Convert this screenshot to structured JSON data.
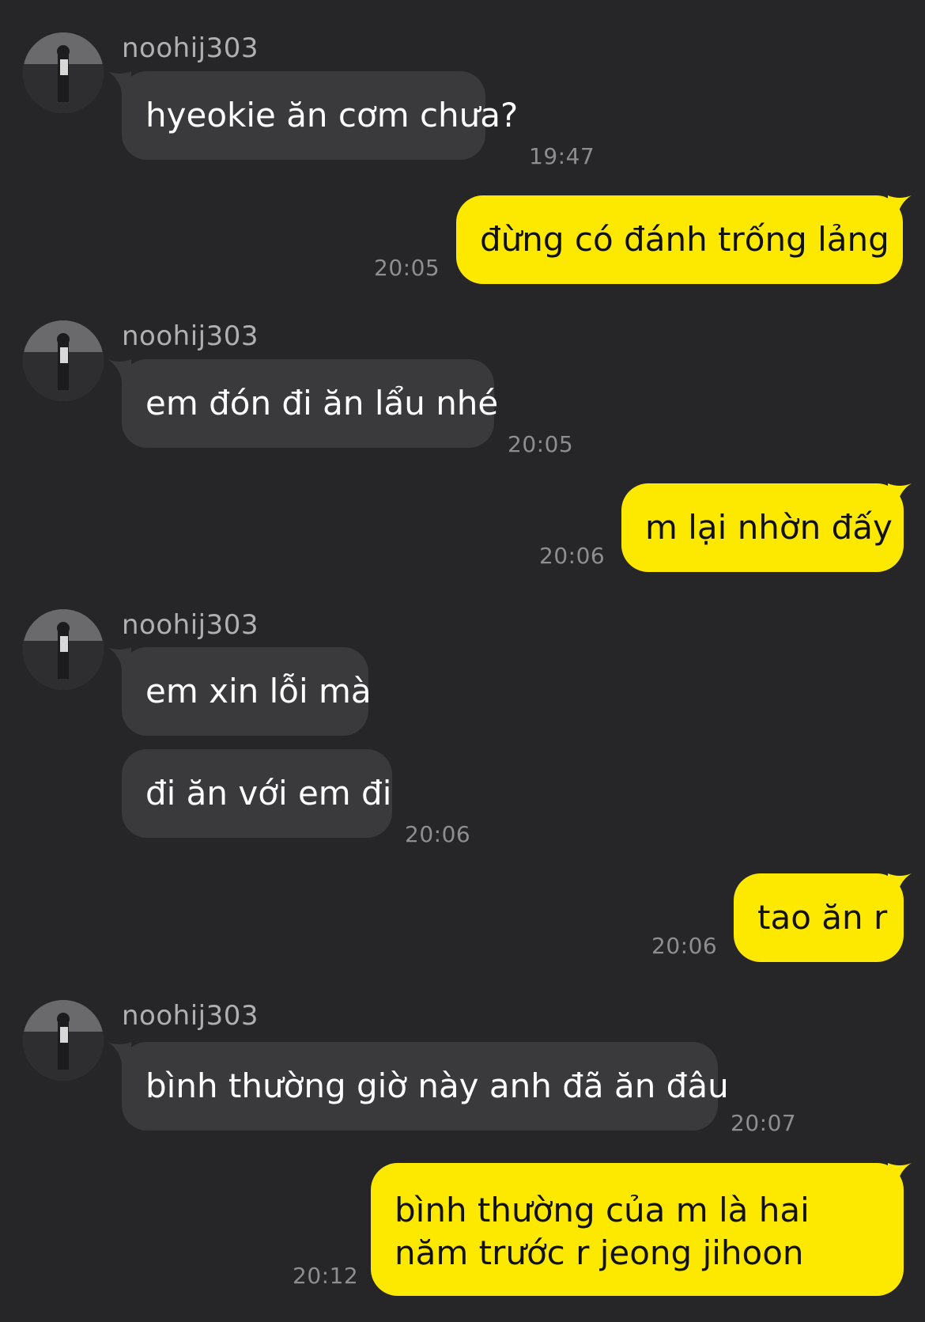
{
  "theme": {
    "background": "#262628",
    "incoming_bubble": "#3a3a3c",
    "outgoing_bubble": "#fde900",
    "timestamp_color": "#8e8e92"
  },
  "contact": {
    "name": "noohij303",
    "avatar_icon": "profile-photo"
  },
  "messages": [
    {
      "from": "contact",
      "sender": "noohij303",
      "text": "hyeokie ăn cơm chưa?",
      "time": "19:47"
    },
    {
      "from": "me",
      "text": "đừng có đánh trống lảng",
      "time": "20:05"
    },
    {
      "from": "contact",
      "sender": "noohij303",
      "text": "em đón đi ăn lẩu nhé",
      "time": "20:05"
    },
    {
      "from": "me",
      "text": "m lại nhờn đấy",
      "time": "20:06"
    },
    {
      "from": "contact",
      "sender": "noohij303",
      "text": "em xin lỗi mà",
      "time": ""
    },
    {
      "from": "contact",
      "sender": "",
      "text": "đi ăn với em đi",
      "time": "20:06"
    },
    {
      "from": "me",
      "text": "tao ăn r",
      "time": "20:06"
    },
    {
      "from": "contact",
      "sender": "noohij303",
      "text": "bình thường giờ này anh đã ăn đâu",
      "time": "20:07"
    },
    {
      "from": "me",
      "text": "bình thường của m là hai năm trước r jeong jihoon",
      "time": "20:12"
    }
  ]
}
